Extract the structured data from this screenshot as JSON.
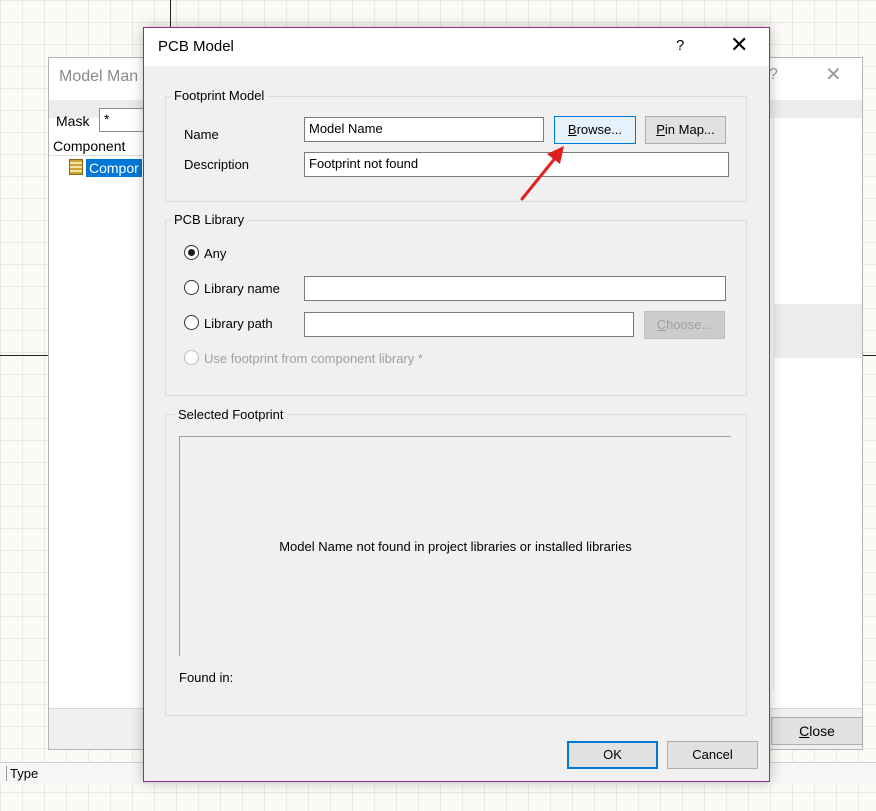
{
  "background": {
    "status_type_label": "Type"
  },
  "model_manager": {
    "title": "Model Man",
    "help": "?",
    "close": "✕",
    "mask_label": "Mask",
    "mask_value": "*",
    "component_header": "Component",
    "tree_item": "Compor",
    "close_button_prefix": "",
    "close_button_mnemonic": "C",
    "close_button_rest": "lose"
  },
  "dialog": {
    "title": "PCB Model",
    "help": "?",
    "close": "✕",
    "footprint_model": {
      "group_label": "Footprint Model",
      "name_label": "Name",
      "name_value": "Model Name",
      "description_label": "Description",
      "description_value": "Footprint not found",
      "browse_mnemonic": "B",
      "browse_rest": "rowse...",
      "pinmap_mnemonic": "P",
      "pinmap_rest": "in Map..."
    },
    "pcb_library": {
      "group_label": "PCB Library",
      "option_any": "Any",
      "option_library_name": "Library name",
      "option_library_path": "Library path",
      "option_use_footprint": "Use footprint from component library *",
      "library_name_value": "",
      "library_path_value": "",
      "choose_mnemonic": "C",
      "choose_rest": "hoose...",
      "selected_option": "Any"
    },
    "selected_footprint": {
      "group_label": "Selected Footprint",
      "message": "Model Name not found in project libraries or installed libraries",
      "found_in_label": "Found in:"
    },
    "ok_label": "OK",
    "cancel_label": "Cancel"
  },
  "colors": {
    "dialog_border": "#8e2b8e",
    "accent": "#0078d7",
    "annotation_arrow": "#e02020"
  }
}
